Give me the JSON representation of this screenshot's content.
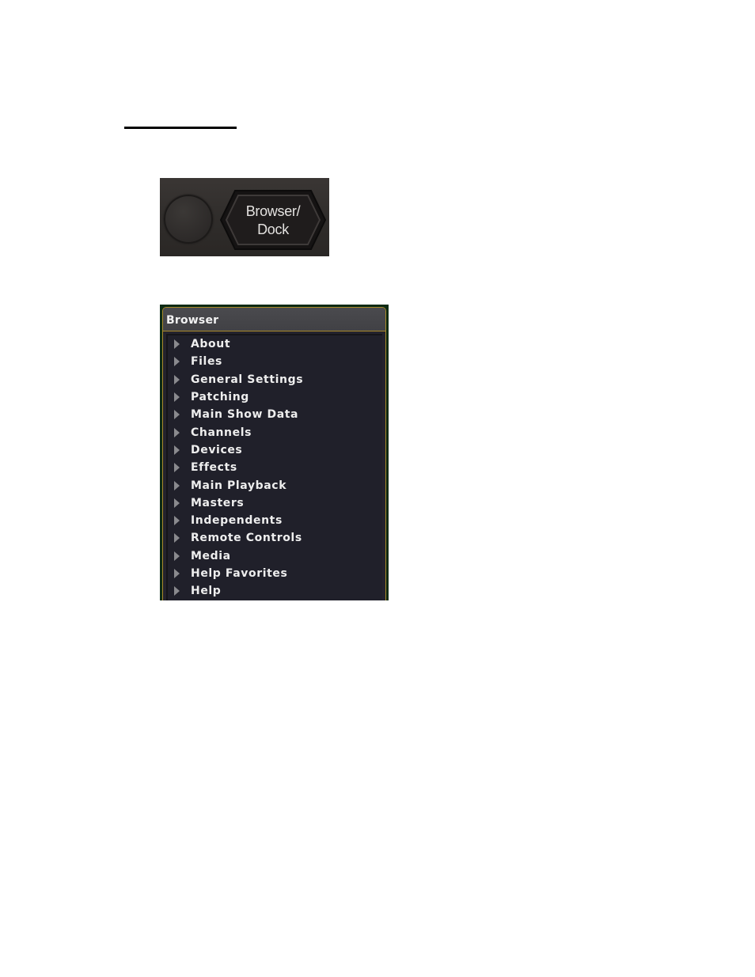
{
  "heading_rule": {
    "type": "underline-rule"
  },
  "hardware_keys": {
    "round_key": {
      "label": ""
    },
    "browser_dock_key": {
      "label": "Browser/\nDock",
      "icon": "hexagon-key-shape"
    }
  },
  "browser": {
    "title": "Browser",
    "expand_icon": "triangle-right",
    "colors": {
      "frame_border": "#a8892a",
      "outer_background": "#0c2a14",
      "header_background": "#454549",
      "list_background": "#20202a",
      "text": "#eeeeee",
      "arrow": "#8a8a8e"
    },
    "items": [
      {
        "label": "About"
      },
      {
        "label": "Files"
      },
      {
        "label": "General Settings"
      },
      {
        "label": "Patching"
      },
      {
        "label": "Main Show Data"
      },
      {
        "label": "Channels"
      },
      {
        "label": "Devices"
      },
      {
        "label": "Effects"
      },
      {
        "label": "Main Playback"
      },
      {
        "label": "Masters"
      },
      {
        "label": "Independents"
      },
      {
        "label": "Remote Controls"
      },
      {
        "label": "Media"
      },
      {
        "label": "Help Favorites"
      },
      {
        "label": "Help"
      }
    ]
  }
}
